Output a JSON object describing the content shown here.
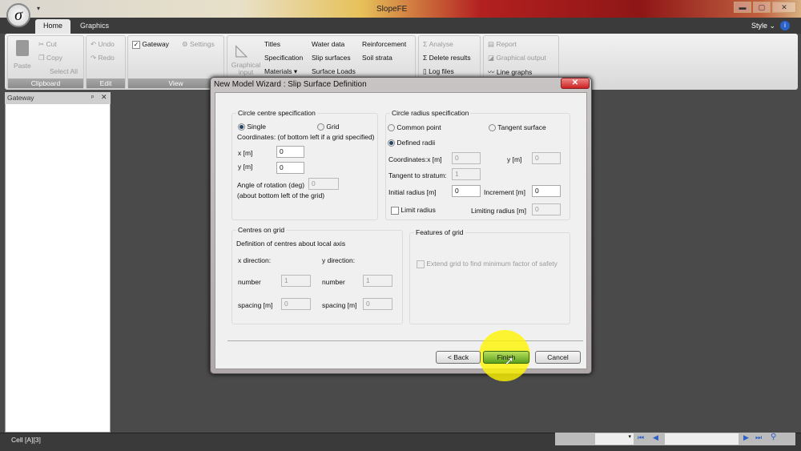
{
  "app": {
    "title": "SlopeFE",
    "logo": "σ"
  },
  "tabs": [
    "Home",
    "Graphics"
  ],
  "style_menu": "Style",
  "ribbon": {
    "clipboard": {
      "label": "Clipboard",
      "paste": "Paste",
      "cut": "Cut",
      "copy": "Copy",
      "select_all": "Select All"
    },
    "edit": {
      "label": "Edit",
      "undo": "Undo",
      "redo": "Redo"
    },
    "view": {
      "label": "View",
      "gateway": "Gateway",
      "gateway_checked": true,
      "settings": "Settings"
    },
    "input": {
      "graphical_input": "Graphical input",
      "titles": "Titles",
      "specification": "Specification",
      "materials": "Materials",
      "water_data": "Water data",
      "slip_surfaces": "Slip surfaces",
      "surface_loads": "Surface Loads",
      "reinforcement": "Reinforcement",
      "soil_strata": "Soil strata"
    },
    "analysis": {
      "analyse": "Analyse",
      "delete_results": "Delete results",
      "log_files": "Log files"
    },
    "output": {
      "report": "Report",
      "graphical_output": "Graphical output",
      "line_graphs": "Line graphs"
    }
  },
  "gateway_panel": {
    "title": "Gateway"
  },
  "status": {
    "cell": "Cell [A][3]"
  },
  "dialog": {
    "title": "New Model Wizard : Slip Surface Definition",
    "circle_centre": {
      "title": "Circle centre specification",
      "single": "Single",
      "grid": "Grid",
      "selected": "Single",
      "coords_label": "Coordinates:  (of bottom left if a grid specified)",
      "x_label": "x  [m]",
      "x_value": "0",
      "y_label": "y  [m]",
      "y_value": "0",
      "angle_label": "Angle of rotation (deg)",
      "angle_value": "0",
      "angle_note": "(about bottom left of the grid)"
    },
    "circle_radius": {
      "title": "Circle radius specification",
      "common_point": "Common point",
      "tangent_surface": "Tangent surface",
      "defined_radii": "Defined radii",
      "selected": "Defined radii",
      "coords_x_label": "Coordinates:x   [m]",
      "coords_x_value": "0",
      "coords_y_label": "y [m]",
      "coords_y_value": "0",
      "tangent_label": "Tangent to stratum:",
      "tangent_value": "1",
      "initial_label": "Initial radius [m]",
      "initial_value": "0",
      "increment_label": "Increment  [m]",
      "increment_value": "0",
      "limit_label": "Limit radius",
      "limiting_label": "Limiting radius  [m]",
      "limiting_value": "0"
    },
    "centres_on_grid": {
      "title": "Centres on grid",
      "definition": "Definition of centres about local axis",
      "x_dir": "x direction:",
      "y_dir": "y direction:",
      "number_label": "number",
      "x_number": "1",
      "y_number": "1",
      "x_spacing_label": "spacing  [m]",
      "y_spacing_label": "spacing [m]",
      "x_spacing": "0",
      "y_spacing": "0"
    },
    "features": {
      "title": "Features of grid",
      "extend": "Extend grid to find minimum factor of safety"
    },
    "buttons": {
      "back": "< Back",
      "finish": "Finish",
      "cancel": "Cancel"
    }
  }
}
